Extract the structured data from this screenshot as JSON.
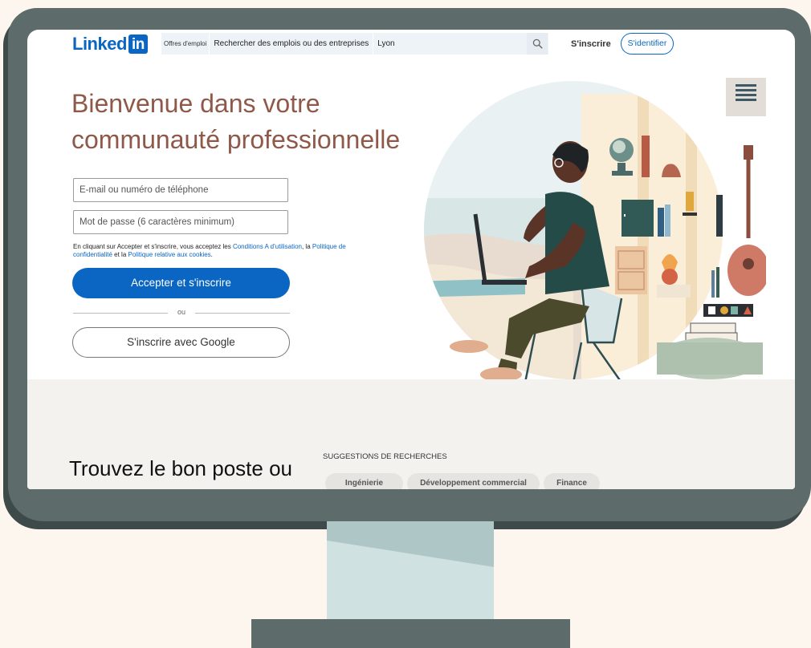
{
  "header": {
    "logo_text": "Linked",
    "logo_box": "in",
    "jobs_segment": "Offres d'emploi",
    "search_placeholder": "Rechercher des emplois ou des entreprises",
    "location_value": "Lyon",
    "join_label": "S'inscrire",
    "signin_label": "S'identifier"
  },
  "hero": {
    "title": "Bienvenue dans votre communauté professionnelle",
    "email_placeholder": "E-mail ou numéro de téléphone",
    "password_placeholder": "Mot de passe (6 caractères minimum)",
    "terms_prefix": "En cliquant sur Accepter et s'inscrire, vous acceptez les ",
    "terms_link": "Conditions A d'utilisation",
    "terms_sep": ", la ",
    "privacy_link": "Politique de confidentialité",
    "terms_and": " et la ",
    "cookies_link": "Politique relative aux cookies",
    "terms_end": ".",
    "accept_button": "Accepter et s'inscrire",
    "or_text": "ou",
    "google_button": "S'inscrire avec Google"
  },
  "lower": {
    "title": "Trouvez le bon poste ou",
    "suggestions_label": "SUGGESTIONS DE RECHERCHES",
    "chips": [
      "Ingénierie",
      "Développement commercial",
      "Finance"
    ]
  },
  "colors": {
    "brand": "#0a66c2",
    "headline": "#8f5849",
    "bezel": "#5d6b6a",
    "background": "#fcf6ef"
  }
}
